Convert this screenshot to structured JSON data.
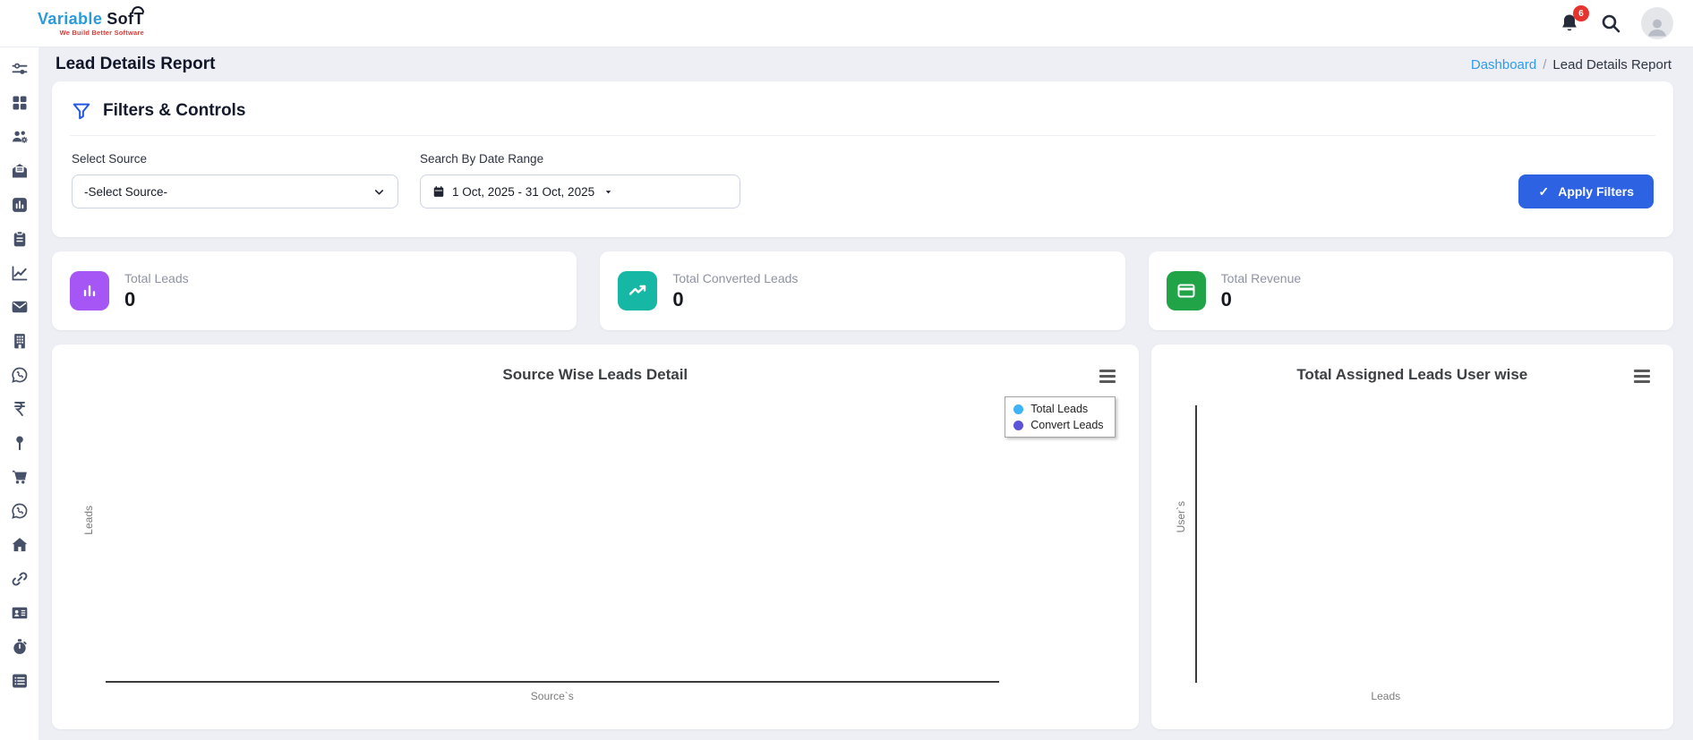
{
  "brand": {
    "name_primary": "Variable",
    "name_secondary": "Sof",
    "name_secondary_t": "T",
    "tagline": "We Build Better Software"
  },
  "header": {
    "notification_count": "6"
  },
  "page": {
    "title": "Lead Details Report"
  },
  "breadcrumb": {
    "link": "Dashboard",
    "separator": "/",
    "current": "Lead Details Report"
  },
  "filters": {
    "title": "Filters & Controls",
    "select_source": {
      "label": "Select Source",
      "value": "-Select Source-"
    },
    "date_range": {
      "label": "Search By Date Range",
      "value": "1 Oct, 2025 - 31 Oct, 2025"
    },
    "apply_label": "Apply Filters",
    "apply_check": "✓"
  },
  "stats": {
    "cards": [
      {
        "label": "Total Leads",
        "value": "0",
        "icon": "bar-chart-icon",
        "color": "#a656f5"
      },
      {
        "label": "Total Converted Leads",
        "value": "0",
        "icon": "trend-up-icon",
        "color": "#16b8a5"
      },
      {
        "label": "Total Revenue",
        "value": "0",
        "icon": "credit-card-icon",
        "color": "#21a347"
      }
    ]
  },
  "sidebar": {
    "items": [
      {
        "icon": "sliders-icon"
      },
      {
        "icon": "grid-icon"
      },
      {
        "icon": "users-gear-icon"
      },
      {
        "icon": "envelope-open-icon"
      },
      {
        "icon": "bar-chart-square-icon"
      },
      {
        "icon": "clipboard-icon"
      },
      {
        "icon": "line-chart-icon"
      },
      {
        "icon": "envelope-icon"
      },
      {
        "icon": "building-icon"
      },
      {
        "icon": "whatsapp-icon"
      },
      {
        "icon": "rupee-icon"
      },
      {
        "icon": "map-pin-icon"
      },
      {
        "icon": "cart-icon"
      },
      {
        "icon": "whatsapp-icon"
      },
      {
        "icon": "home-icon"
      },
      {
        "icon": "link-icon"
      },
      {
        "icon": "id-card-icon"
      },
      {
        "icon": "stopwatch-icon"
      },
      {
        "icon": "list-icon"
      }
    ]
  },
  "colors": {
    "accent_blue": "#2d63e2",
    "link_blue": "#2e9bf0",
    "badge_red": "#e5342e"
  },
  "chart_data": [
    {
      "type": "bar",
      "title": "Source Wise Leads Detail",
      "xlabel": "Source`s",
      "ylabel": "Leads",
      "categories": [],
      "series": [
        {
          "name": "Total Leads",
          "color": "#3fb3f6",
          "values": []
        },
        {
          "name": "Convert Leads",
          "color": "#5b53d8",
          "values": []
        }
      ],
      "legend_position": "top-right"
    },
    {
      "type": "bar",
      "title": "Total Assigned Leads User wise",
      "xlabel": "Leads",
      "ylabel": "User`s",
      "categories": [],
      "values": []
    }
  ]
}
